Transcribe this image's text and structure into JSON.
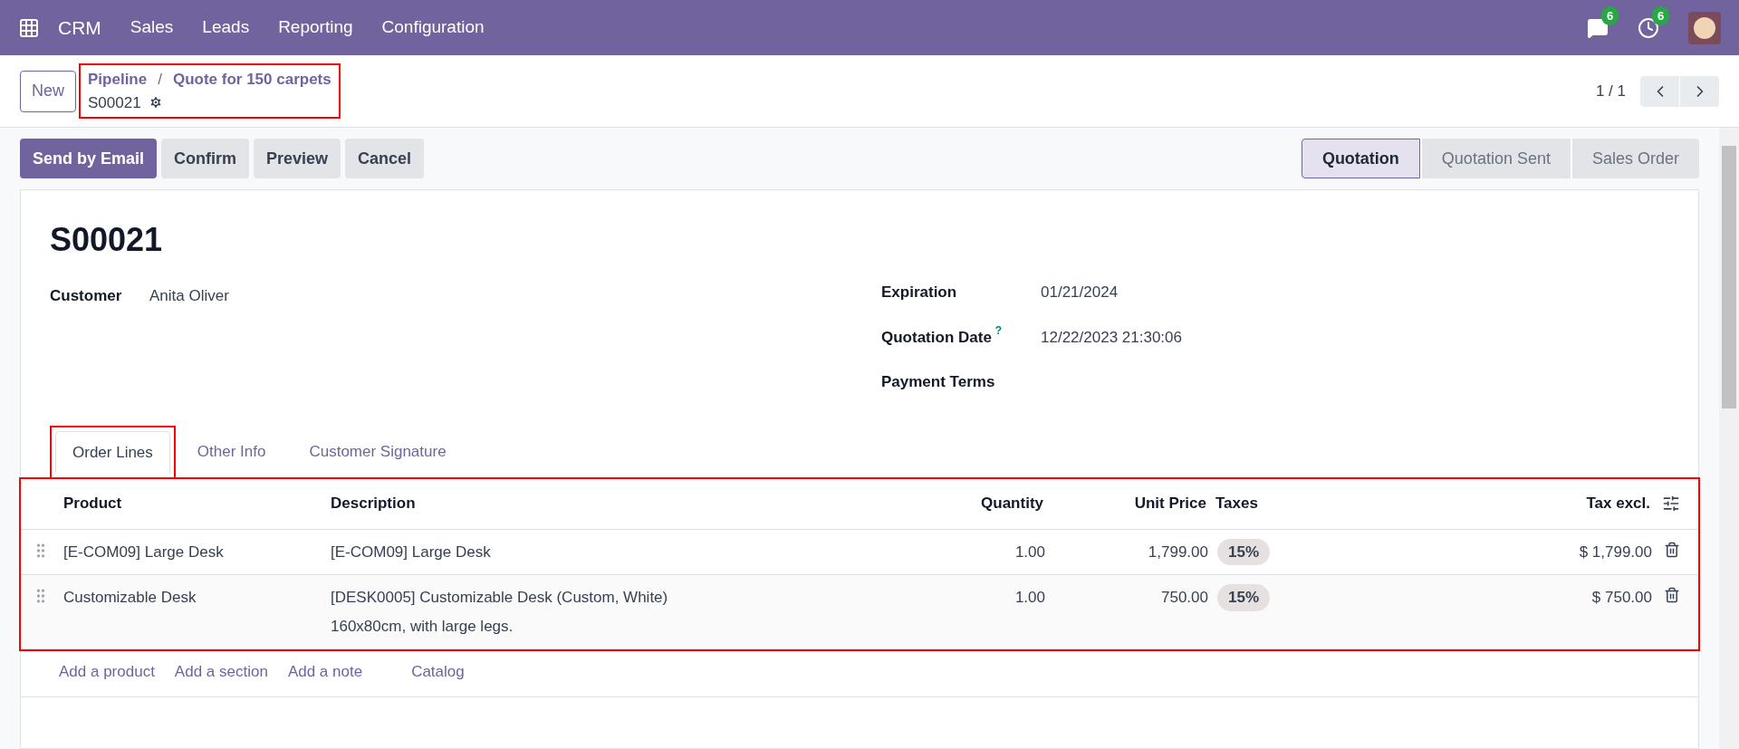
{
  "navbar": {
    "app": "CRM",
    "menu": [
      "Sales",
      "Leads",
      "Reporting",
      "Configuration"
    ],
    "messages_badge": "6",
    "activities_badge": "6"
  },
  "control_panel": {
    "new_button": "New",
    "breadcrumb": {
      "highlighted": true,
      "parent": "Pipeline",
      "separator": "/",
      "current": "Quote for 150 carpets",
      "record": "S00021"
    },
    "pager": "1 / 1"
  },
  "actions": [
    {
      "label": "Send by Email",
      "primary": true
    },
    {
      "label": "Confirm",
      "primary": false
    },
    {
      "label": "Preview",
      "primary": false
    },
    {
      "label": "Cancel",
      "primary": false
    }
  ],
  "status_bar": [
    {
      "label": "Quotation",
      "selected": true
    },
    {
      "label": "Quotation Sent",
      "selected": false
    },
    {
      "label": "Sales Order",
      "selected": false
    }
  ],
  "form": {
    "title": "S00021",
    "left_fields": [
      {
        "label": "Customer",
        "value": "Anita Oliver"
      }
    ],
    "right_fields": [
      {
        "label": "Expiration",
        "value": "01/21/2024"
      },
      {
        "label": "Quotation Date",
        "value": "12/22/2023 21:30:06",
        "help": "?"
      },
      {
        "label": "Payment Terms"
      }
    ],
    "tabs": [
      {
        "label": "Order Lines",
        "selected": true,
        "highlighted": true
      },
      {
        "label": "Other Info",
        "selected": false,
        "highlighted": false
      },
      {
        "label": "Customer Signature",
        "selected": false,
        "highlighted": false
      }
    ],
    "table": {
      "highlighted": true,
      "columns": [
        "Product",
        "Description",
        "Quantity",
        "Unit Price",
        "Taxes",
        "Tax excl."
      ],
      "rows": [
        {
          "product": "[E-COM09] Large Desk",
          "description": [
            "[E-COM09] Large Desk"
          ],
          "quantity": "1.00",
          "unit_price": "1,799.00",
          "taxes": "15%",
          "tax_excl": "$ 1,799.00"
        },
        {
          "product": "Customizable Desk",
          "description": [
            "[DESK0005] Customizable Desk (Custom, White)",
            "160x80cm, with large legs."
          ],
          "quantity": "1.00",
          "unit_price": "750.00",
          "taxes": "15%",
          "tax_excl": "$ 750.00"
        }
      ],
      "add_links": [
        "Add a product",
        "Add a section",
        "Add a note",
        "Catalog"
      ]
    }
  }
}
